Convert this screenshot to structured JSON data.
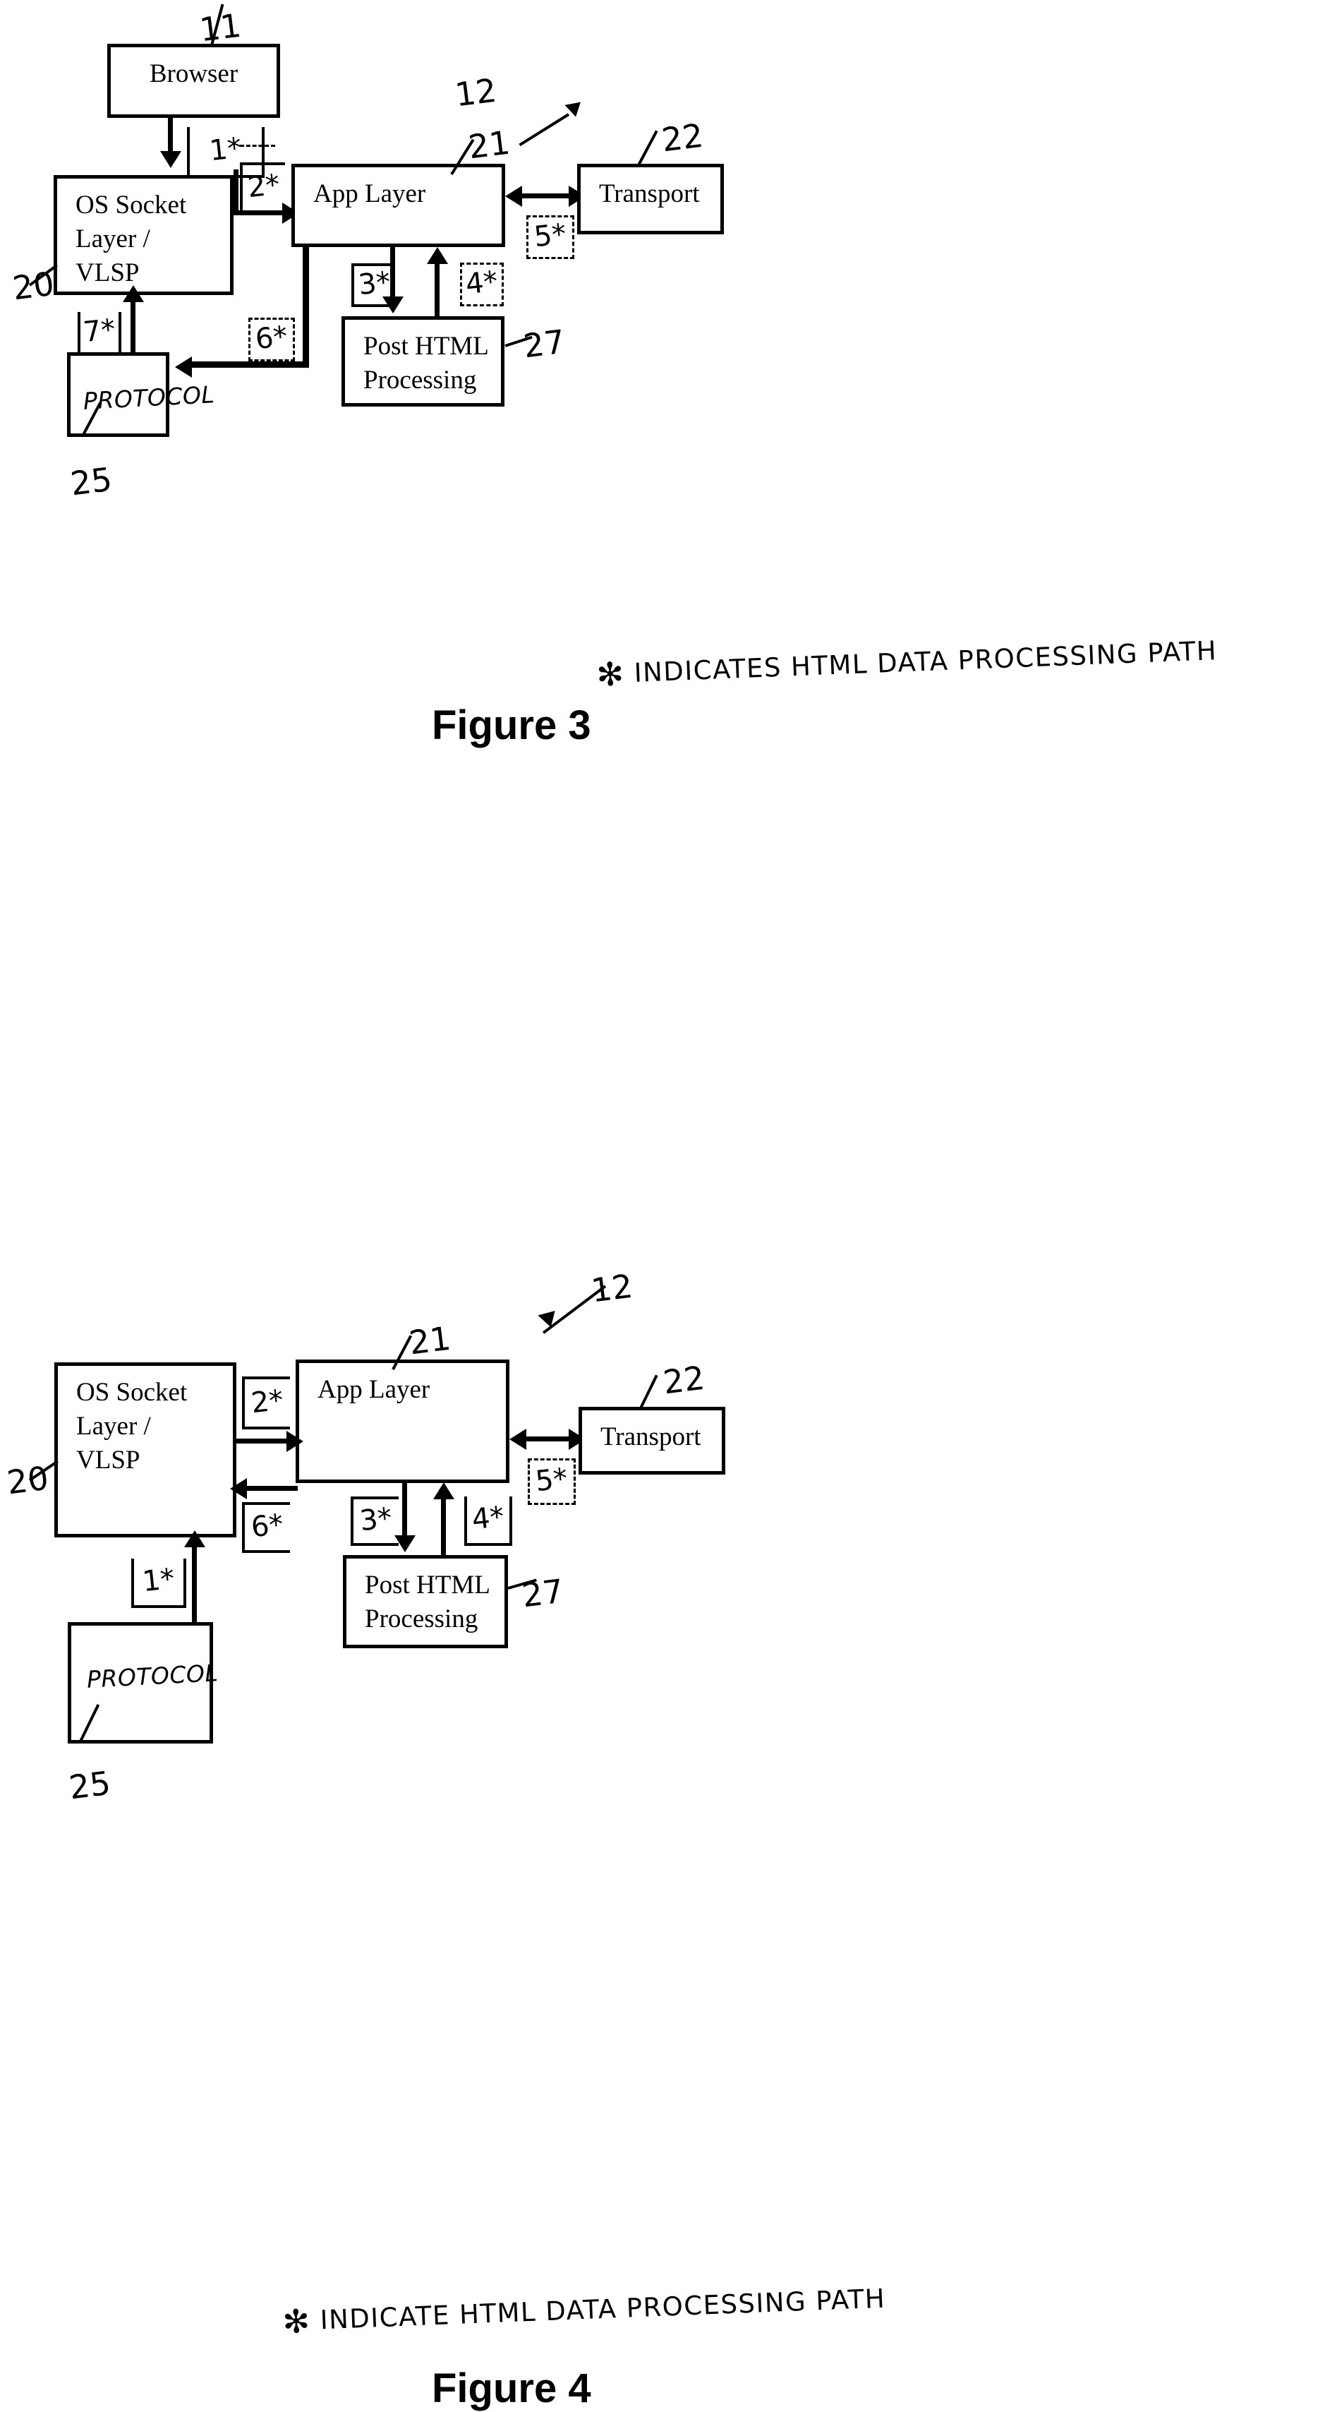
{
  "document": {
    "type": "patent-drawing-sheet",
    "figures": [
      {
        "id": "figure-3",
        "caption": "Figure 3",
        "footnote": "INDICATES HTML DATA PROCESSING PATH",
        "footnote_marker": "*",
        "boxes": [
          {
            "key": "browser",
            "lines": [
              "Browser"
            ],
            "ref": "11"
          },
          {
            "key": "os_socket",
            "lines": [
              "OS Socket",
              "Layer /",
              "VLSP"
            ],
            "ref": "20"
          },
          {
            "key": "app_layer",
            "lines": [
              "App Layer"
            ],
            "ref": "21"
          },
          {
            "key": "transport",
            "lines": [
              "Transport"
            ],
            "ref": "22"
          },
          {
            "key": "post_html",
            "lines": [
              "Post HTML",
              "Processing"
            ],
            "ref": "27"
          },
          {
            "key": "protocol",
            "lines": [
              "PROTOCOL"
            ],
            "ref": "25"
          }
        ],
        "system_ref": "12",
        "steps": [
          {
            "label": "1*",
            "from": "browser",
            "to": "os_socket"
          },
          {
            "label": "2*",
            "from": "os_socket",
            "to": "app_layer"
          },
          {
            "label": "3*",
            "from": "app_layer",
            "to": "post_html"
          },
          {
            "label": "4*",
            "from": "post_html",
            "to": "app_layer"
          },
          {
            "label": "5*",
            "from": "app_layer",
            "to": "transport"
          },
          {
            "label": "6*",
            "from": "app_layer",
            "to": "protocol"
          },
          {
            "label": "7*",
            "from": "protocol",
            "to": "os_socket"
          }
        ]
      },
      {
        "id": "figure-4",
        "caption": "Figure 4",
        "footnote": "INDICATE HTML DATA PROCESSING PATH",
        "footnote_marker": "*",
        "boxes": [
          {
            "key": "os_socket",
            "lines": [
              "OS Socket",
              "Layer /",
              "VLSP"
            ],
            "ref": "20"
          },
          {
            "key": "app_layer",
            "lines": [
              "App Layer"
            ],
            "ref": "21"
          },
          {
            "key": "transport",
            "lines": [
              "Transport"
            ],
            "ref": "22"
          },
          {
            "key": "post_html",
            "lines": [
              "Post HTML",
              "Processing"
            ],
            "ref": "27"
          },
          {
            "key": "protocol",
            "lines": [
              "PROTOCOL"
            ],
            "ref": "25"
          }
        ],
        "system_ref": "12",
        "steps": [
          {
            "label": "1*",
            "from": "protocol",
            "to": "os_socket"
          },
          {
            "label": "2*",
            "from": "os_socket",
            "to": "app_layer"
          },
          {
            "label": "3*",
            "from": "app_layer",
            "to": "post_html"
          },
          {
            "label": "4*",
            "from": "post_html",
            "to": "app_layer"
          },
          {
            "label": "5*",
            "from": "app_layer",
            "to": "transport"
          },
          {
            "label": "6*",
            "from": "app_layer",
            "to": "os_socket"
          }
        ]
      }
    ]
  },
  "f3": {
    "browser": {
      "l1": "Browser"
    },
    "os_socket": {
      "l1": "OS Socket",
      "l2": "Layer /",
      "l3": "VLSP"
    },
    "app_layer": {
      "l1": "App Layer"
    },
    "transport": {
      "l1": "Transport"
    },
    "post_html": {
      "l1": "Post HTML",
      "l2": "Processing"
    },
    "protocol": {
      "l1": "PROTOCOL"
    },
    "ref_11": "11",
    "ref_12": "12",
    "ref_20": "20",
    "ref_21": "21",
    "ref_22": "22",
    "ref_25": "25",
    "ref_27": "27",
    "step_1": "1*",
    "step_2": "2*",
    "step_3": "3*",
    "step_4": "4*",
    "step_5": "5*",
    "step_6": "6*",
    "step_7": "7*",
    "footnote_star": "✻",
    "footnote_text": "INDICATES  HTML  DATA  PROCESSING  PATH",
    "caption": "Figure 3"
  },
  "f4": {
    "os_socket": {
      "l1": "OS Socket",
      "l2": "Layer /",
      "l3": "VLSP"
    },
    "app_layer": {
      "l1": "App Layer"
    },
    "transport": {
      "l1": "Transport"
    },
    "post_html": {
      "l1": "Post HTML",
      "l2": "Processing"
    },
    "protocol": {
      "l1": "PROTOCOL"
    },
    "ref_12": "12",
    "ref_20": "20",
    "ref_21": "21",
    "ref_22": "22",
    "ref_25": "25",
    "ref_27": "27",
    "step_1": "1*",
    "step_2": "2*",
    "step_3": "3*",
    "step_4": "4*",
    "step_5": "5*",
    "step_6": "6*",
    "footnote_star": "✻",
    "footnote_text": "INDICATE  HTML  DATA  PROCESSING  PATH",
    "caption": "Figure 4"
  }
}
